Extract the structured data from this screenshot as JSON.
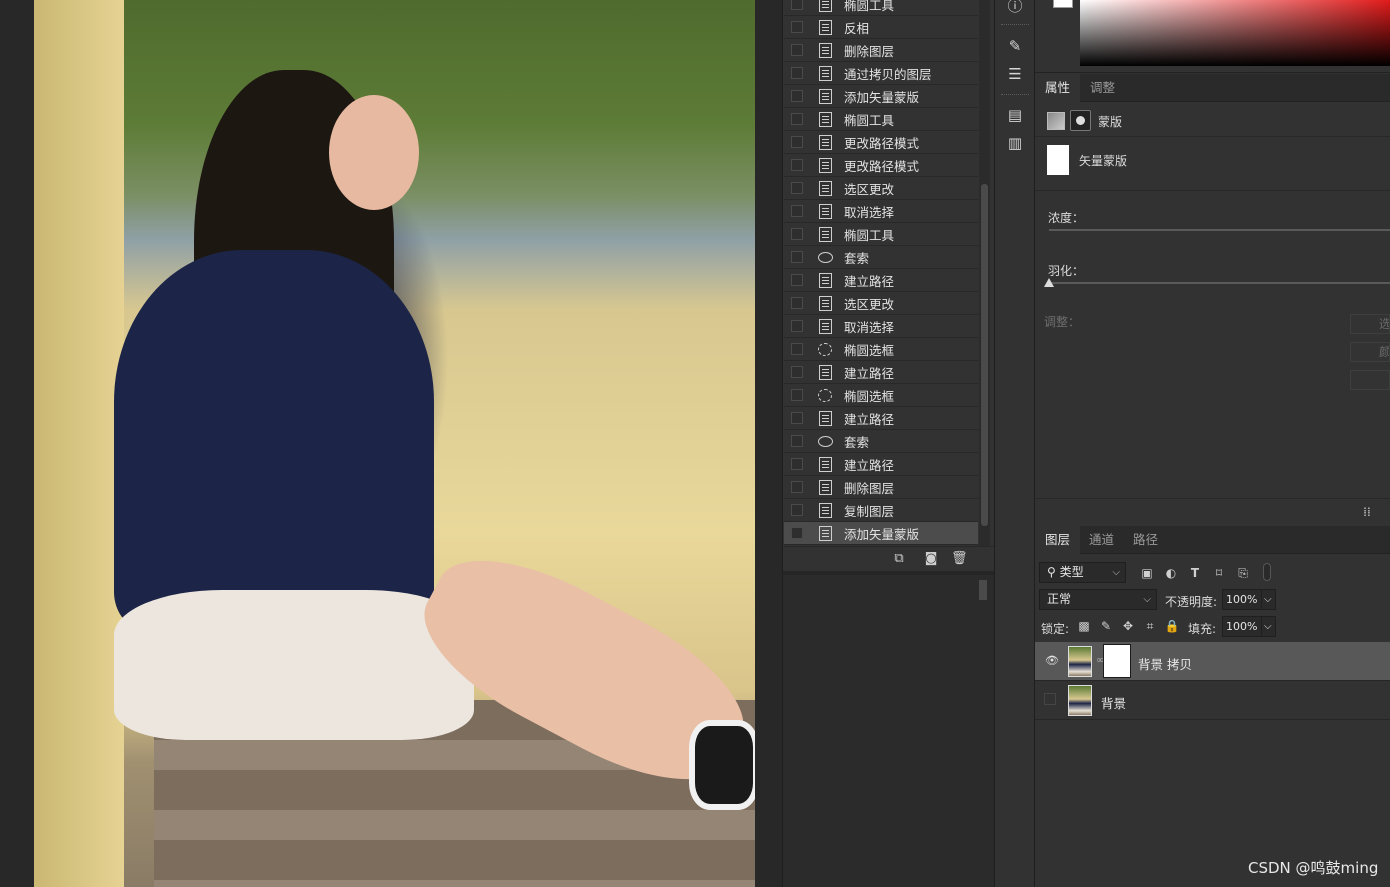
{
  "history": {
    "items": [
      {
        "label": "椭圆工具",
        "icon": "document-icon"
      },
      {
        "label": "反相",
        "icon": "document-icon"
      },
      {
        "label": "删除图层",
        "icon": "document-icon"
      },
      {
        "label": "通过拷贝的图层",
        "icon": "document-icon"
      },
      {
        "label": "添加矢量蒙版",
        "icon": "document-icon"
      },
      {
        "label": "椭圆工具",
        "icon": "document-icon"
      },
      {
        "label": "更改路径模式",
        "icon": "document-icon"
      },
      {
        "label": "更改路径模式",
        "icon": "document-icon"
      },
      {
        "label": "选区更改",
        "icon": "document-icon"
      },
      {
        "label": "取消选择",
        "icon": "document-icon"
      },
      {
        "label": "椭圆工具",
        "icon": "document-icon"
      },
      {
        "label": "套索",
        "icon": "lasso-icon"
      },
      {
        "label": "建立路径",
        "icon": "document-icon"
      },
      {
        "label": "选区更改",
        "icon": "document-icon"
      },
      {
        "label": "取消选择",
        "icon": "document-icon"
      },
      {
        "label": "椭圆选框",
        "icon": "elliptical-marquee-icon"
      },
      {
        "label": "建立路径",
        "icon": "document-icon"
      },
      {
        "label": "椭圆选框",
        "icon": "elliptical-marquee-icon"
      },
      {
        "label": "建立路径",
        "icon": "document-icon"
      },
      {
        "label": "套索",
        "icon": "lasso-icon"
      },
      {
        "label": "建立路径",
        "icon": "document-icon"
      },
      {
        "label": "删除图层",
        "icon": "document-icon"
      },
      {
        "label": "复制图层",
        "icon": "document-icon"
      },
      {
        "label": "添加矢量蒙版",
        "icon": "document-icon",
        "active": true
      }
    ],
    "footer_icons": [
      "new-document-from-state-icon",
      "camera-snapshot-icon",
      "trash-icon"
    ]
  },
  "tools": [
    "info-icon",
    "brush-icon",
    "adjust-sliders-icon",
    "panel-icon",
    "notes-icon"
  ],
  "color": {
    "foreground": "#ffffff",
    "hue": "#e21b1b"
  },
  "properties": {
    "tabs": [
      "属性",
      "调整"
    ],
    "mask_type_label": "蒙版",
    "vector_mask_label": "矢量蒙版",
    "density_label": "浓度：",
    "feather_label": "羽化：",
    "adjust_label": "调整：",
    "buttons": [
      "选择",
      "颜色",
      ""
    ]
  },
  "layers": {
    "tabs": [
      "图层",
      "通道",
      "路径"
    ],
    "filter_kind": "类型",
    "blend_mode": "正常",
    "opacity_label": "不透明度:",
    "opacity_value": "100%",
    "lock_label": "锁定:",
    "fill_label": "填充:",
    "fill_value": "100%",
    "items": [
      {
        "name": "背景 拷贝",
        "visible": true,
        "has_mask": true,
        "selected": true
      },
      {
        "name": "背景",
        "visible": false,
        "has_mask": false,
        "selected": false
      }
    ]
  },
  "watermark": "CSDN @鸣鼓ming"
}
